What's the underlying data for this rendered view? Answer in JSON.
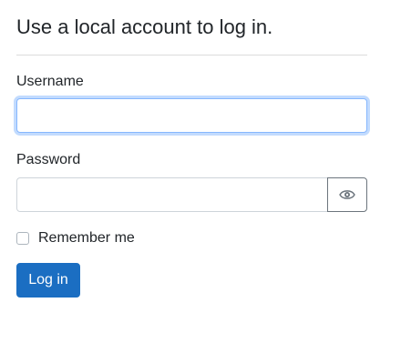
{
  "form": {
    "heading": "Use a local account to log in.",
    "username": {
      "label": "Username",
      "value": "",
      "placeholder": ""
    },
    "password": {
      "label": "Password",
      "value": "",
      "placeholder": "",
      "toggle_icon": "eye-icon"
    },
    "remember_me": {
      "label": "Remember me",
      "checked": false
    },
    "submit_label": "Log in"
  },
  "colors": {
    "primary_button": "#1b6ec2",
    "focus_border": "#86b7fe",
    "text": "#212529"
  }
}
